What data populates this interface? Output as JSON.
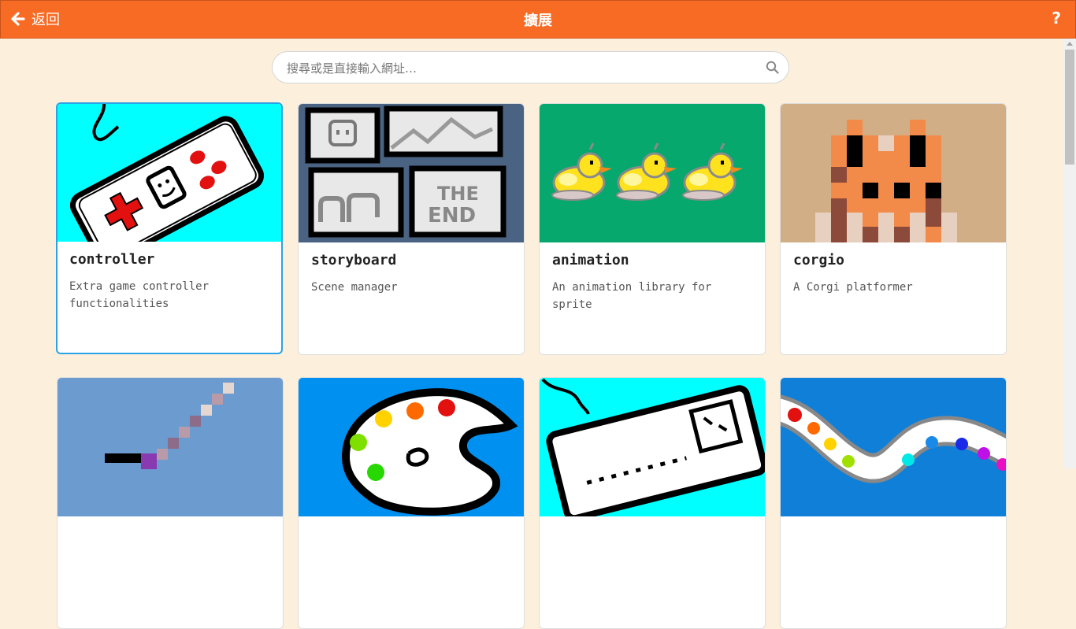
{
  "header": {
    "back_label": "返回",
    "title": "擴展",
    "help_label": "?"
  },
  "search": {
    "placeholder": "搜尋或是直接輸入網址…",
    "value": ""
  },
  "extensions": [
    {
      "name": "controller",
      "description": "Extra game controller functionalities",
      "image": "gamepad-icon",
      "bg": "#00ffff"
    },
    {
      "name": "storyboard",
      "description": "Scene manager",
      "image": "storyboard-icon",
      "bg": "#4a6382"
    },
    {
      "name": "animation",
      "description": "An animation library for sprite",
      "image": "ducks-icon",
      "bg": "#06a86e"
    },
    {
      "name": "corgio",
      "description": "A Corgi platformer",
      "image": "corgi-icon",
      "bg": "#d2ae86"
    },
    {
      "name": "",
      "description": "",
      "image": "sword-icon",
      "bg": "#6b9bcf"
    },
    {
      "name": "",
      "description": "",
      "image": "palette-icon",
      "bg": "#0090f0"
    },
    {
      "name": "",
      "description": "",
      "image": "keyboard-icon",
      "bg": "#00ffff"
    },
    {
      "name": "",
      "description": "",
      "image": "color-track-icon",
      "bg": "#0f7fd8"
    }
  ],
  "colors": {
    "topbar": "#f76b25",
    "background": "#fcf0dc",
    "selected_border": "#2aa3e6"
  }
}
